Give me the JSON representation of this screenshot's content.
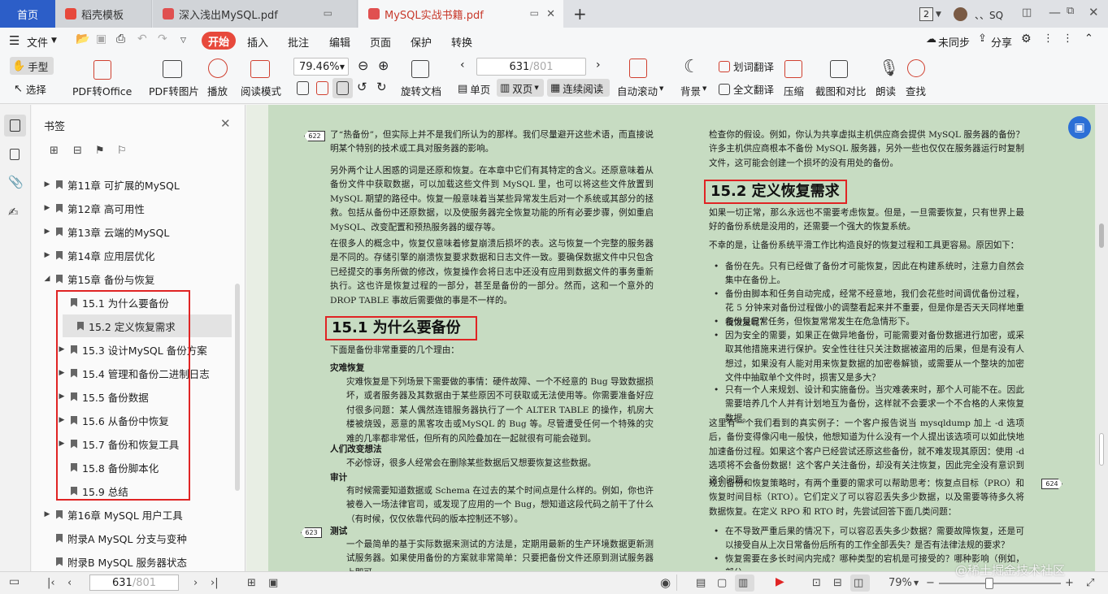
{
  "tabs": {
    "home": "首页",
    "t1": "稻壳模板",
    "t2": "深入浅出MySQL.pdf",
    "t3": "MySQL实战书籍.pdf",
    "new": "+"
  },
  "window": {
    "badge": "2",
    "user": "、、SQ"
  },
  "menu": {
    "file": "文件",
    "start": "开始",
    "insert": "插入",
    "annotate": "批注",
    "edit": "编辑",
    "page": "页面",
    "protect": "保护",
    "convert": "转换",
    "unsynced": "未同步",
    "share": "分享"
  },
  "toolbar": {
    "hand": "手型",
    "select": "选择",
    "pdf2office": "PDF转Office",
    "pdf2img": "PDF转图片",
    "play": "播放",
    "read_mode": "阅读模式",
    "zoom": "79.46%",
    "rotate": "旋转文档",
    "page_input": "631",
    "page_total": "/801",
    "single": "单页",
    "double": "双页",
    "continuous": "连续阅读",
    "autoscroll": "自动滚动",
    "background": "背景",
    "word_trans": "划词翻译",
    "full_trans": "全文翻译",
    "compress": "压缩",
    "screenshot": "截图和对比",
    "read_aloud": "朗读",
    "find": "查找"
  },
  "bookmarks": {
    "title": "书签",
    "items": [
      {
        "label": "第11章 可扩展的MySQL",
        "arrow": "▶",
        "indent": 0
      },
      {
        "label": "第12章 高可用性",
        "arrow": "▶",
        "indent": 0
      },
      {
        "label": "第13章 云端的MySQL",
        "arrow": "▶",
        "indent": 0
      },
      {
        "label": "第14章 应用层优化",
        "arrow": "▶",
        "indent": 0
      },
      {
        "label": "第15章 备份与恢复",
        "arrow": "◢",
        "indent": 0
      },
      {
        "label": "15.1 为什么要备份",
        "arrow": "",
        "indent": 1
      },
      {
        "label": "15.2 定义恢复需求",
        "arrow": "",
        "indent": 1
      },
      {
        "label": "15.3 设计MySQL 备份方案",
        "arrow": "▶",
        "indent": 1
      },
      {
        "label": "15.4 管理和备份二进制日志",
        "arrow": "▶",
        "indent": 1
      },
      {
        "label": "15.5 备份数据",
        "arrow": "▶",
        "indent": 1
      },
      {
        "label": "15.6 从备份中恢复",
        "arrow": "▶",
        "indent": 1
      },
      {
        "label": "15.7 备份和恢复工具",
        "arrow": "▶",
        "indent": 1
      },
      {
        "label": "15.8 备份脚本化",
        "arrow": "",
        "indent": 1
      },
      {
        "label": "15.9 总结",
        "arrow": "",
        "indent": 1
      },
      {
        "label": "第16章 MySQL 用户工具",
        "arrow": "▶",
        "indent": 0
      },
      {
        "label": "附录A MySQL 分支与变种",
        "arrow": "",
        "indent": 0
      },
      {
        "label": "附录B MySQL 服务器状态",
        "arrow": "",
        "indent": 0
      }
    ]
  },
  "doc": {
    "pn622": "622",
    "pn623": "623",
    "pn624": "624",
    "l_p1": "了“热备份”，但实际上并不是我们所认为的那样。我们尽量避开这些术语，而直接说明某个特别的技术或工具对服务器的影响。",
    "l_p2": "另外两个让人困惑的词是还原和恢复。在本章中它们有其特定的含义。还原意味着从备份文件中获取数据，可以加载这些文件到 MySQL 里，也可以将这些文件放置到 MySQL 期望的路径中。恢复一般意味着当某些异常发生后对一个系统或其部分的拯救。包括从备份中还原数据，以及使服务器完全恢复功能的所有必要步骤，例如重启MySQL、改变配置和预热服务器的缓存等。",
    "l_p3": "在很多人的概念中，恢复仅意味着修复崩溃后损坏的表。这与恢复一个完整的服务器是不同的。存储引擎的崩溃恢复要求数据和日志文件一致。要确保数据文件中只包含已经提交的事务所做的修改，恢复操作会将日志中还没有应用到数据文件的事务重新执行。这也许是恢复过程的一部分，甚至是备份的一部分。然而，这和一个意外的 DROP TABLE 事故后需要做的事是不一样的。",
    "h151": "15.1  为什么要备份",
    "l_intro": "下面是备份非常重要的几个理由：",
    "l_dr": "灾难恢复",
    "l_dr_t": "灾难恢复是下列场景下需要做的事情：硬件故障、一个不经意的 Bug 导致数据损坏，或者服务器及其数据由于某些原因不可获取或无法使用等。你需要准备好应付很多问题：某人偶然连错服务器执行了一个 ALTER TABLE 的操作，机房大楼被烧毁，恶意的黑客攻击或MySQL 的 Bug 等。尽管遭受任何一个特殊的灾难的几率都非常低，但所有的风险叠加在一起就很有可能会碰到。",
    "l_ch": "人们改变想法",
    "l_ch_t": "不必惊讶，很多人经常会在删除某些数据后又想要恢复这些数据。",
    "l_au": "审计",
    "l_au_t": "有时候需要知道数据或 Schema 在过去的某个时间点是什么样的。例如，你也许被卷入一场法律官司，或发现了应用的一个 Bug，想知道这段代码之前干了什么（有时候，仅仅依靠代码的版本控制还不够）。",
    "l_te": "测试",
    "l_te_t": "一个最简单的基于实际数据来测试的方法是，定期用最新的生产环境数据更新测试服务器。如果使用备份的方案就非常简单：只要把备份文件还原到测试服务器上即可。",
    "r_p0": "检查你的假设。例如，你认为共享虚拟主机供应商会提供 MySQL 服务器的备份？许多主机供应商根本不备份 MySQL 服务器，另外一些也仅仅在服务器运行时复制文件，这可能会创建一个损坏的没有用处的备份。",
    "h152": "15.2  定义恢复需求",
    "r_p1": "如果一切正常，那么永远也不需要考虑恢复。但是，一旦需要恢复，只有世界上最好的备份系统是没用的，还需要一个强大的恢复系统。",
    "r_p2": "不幸的是，让备份系统平滑工作比构造良好的恢复过程和工具更容易。原因如下：",
    "r_b1": "备份在先。只有已经做了备份才可能恢复，因此在构建系统时，注意力自然会集中在备份上。",
    "r_b2": "备份由脚本和任务自动完成，经常不经意地，我们会花些时间调优备份过程，花 5 分钟来对备份过程做小的调整看起来并不重要，但是你是否天天同样地重视恢复呢？",
    "r_b3": "备份是日常任务，但恢复常常发生在危急情形下。",
    "r_b4": "因为安全的需要，如果正在做异地备份，可能需要对备份数据进行加密，或采取其他措施来进行保护。安全性往往只关注数据被盗用的后果，但是有没有人想过，如果没有人能对用来恢复数据的加密卷解锁，或需要从一个整块的加密文件中抽取单个文件时，损害又是多大？",
    "r_b5": "只有一个人来规划、设计和实施备份。当灾难袭来时，那个人可能不在。因此需要培养几个人并有计划地互为备份，这样就不会要求一个不合格的人来恢复数据。",
    "r_p3": "这里有一个我们看到的真实例子：一个客户报告说当 mysqldump 加上 -d 选项后，备份变得像闪电一般快，他想知道为什么没有一个人提出该选项可以如此快地加速备份过程。如果这个客户已经尝试还原这些备份，就不难发现其原因：使用 -d 选项将不会备份数据！这个客户关注备份，却没有关注恢复，因此完全没有意识到这个问题。",
    "r_p4": "规划备份和恢复策略时，有两个重要的需求可以帮助思考：恢复点目标（PRO）和恢复时间目标（RTO）。它们定义了可以容忍丢失多少数据，以及需要等待多久将数据恢复。在定义 RPO 和 RTO 时，先尝试回答下面几类问题：",
    "r_b6": "在不导致严重后果的情况下，可以容忍丢失多少数据？需要故障恢复，还是可以接受自从上次日常备份后所有的工作全部丢失？是否有法律法规的要求？",
    "r_b7": "恢复需要在多长时间内完成？哪种类型的宕机是可接受的？哪种影响（例如，部分"
  },
  "status": {
    "page_input": "631",
    "page_total": "/801",
    "zoom": "79%",
    "minus": "−",
    "plus": "+",
    "watermark": "@稀土掘金技术社区"
  },
  "colors": {
    "accent": "#2c5ec8",
    "start": "#e7493c",
    "page_bg": "#c7dcc2",
    "highlight": "#e02424"
  }
}
